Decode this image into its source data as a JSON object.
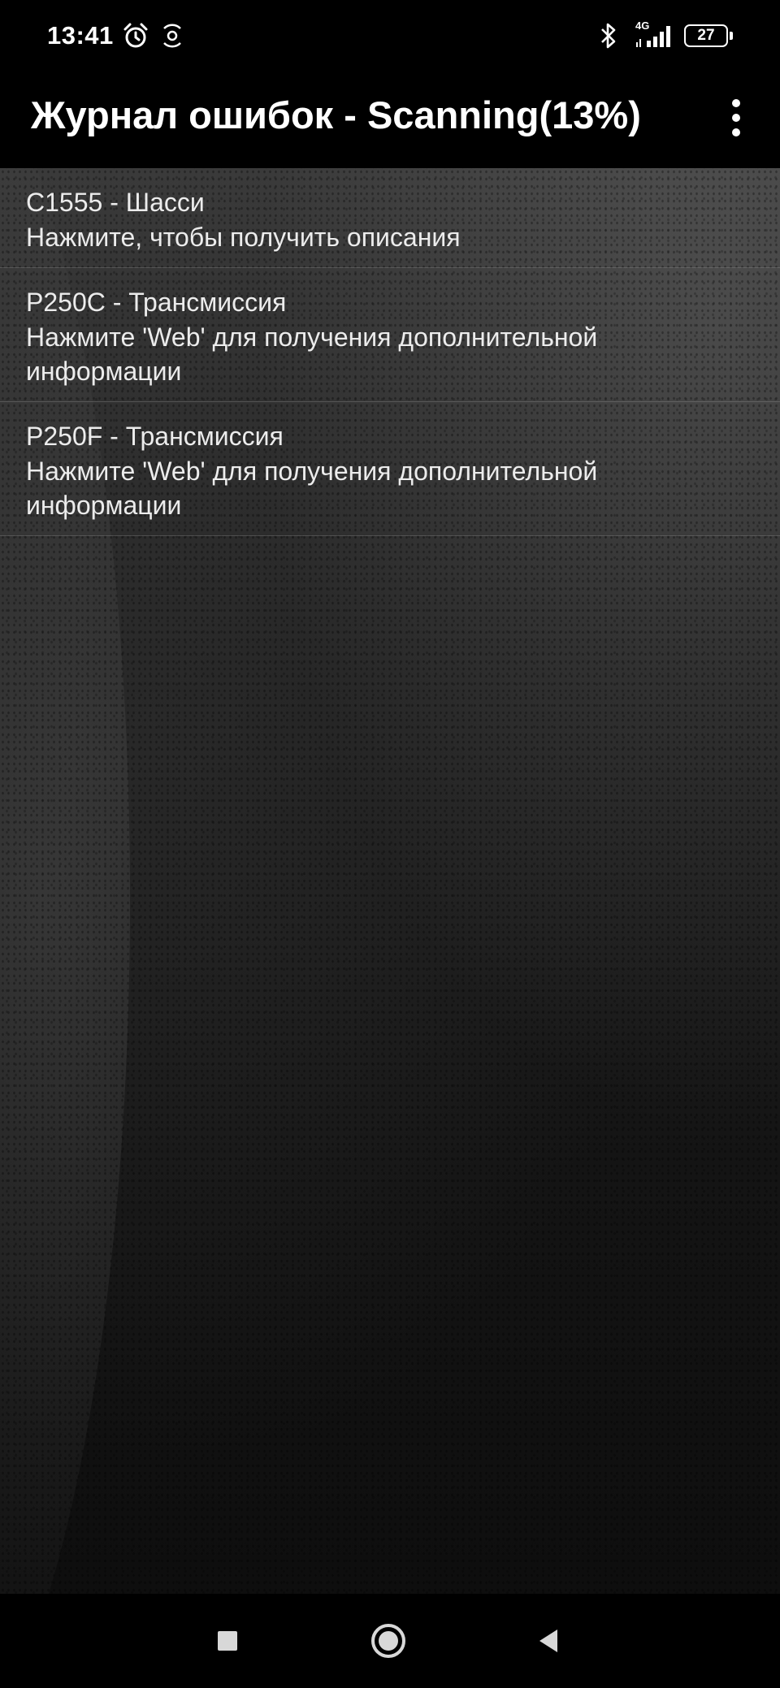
{
  "status_bar": {
    "time": "13:41",
    "network_label": "4G",
    "battery_level": "27",
    "icons": [
      "alarm-icon",
      "hearing-icon",
      "bluetooth-icon",
      "signal-icon",
      "battery-icon"
    ]
  },
  "app_bar": {
    "title": "Журнал ошибок - Scanning(13%)",
    "menu_icon": "more-vert-icon"
  },
  "error_log": {
    "items": [
      {
        "title": "C1555 - Шасси",
        "description": "Нажмите, чтобы получить описания"
      },
      {
        "title": "P250C - Трансмиссия",
        "description": "Нажмите 'Web' для получения дополнительной информации"
      },
      {
        "title": "P250F - Трансмиссия",
        "description": "Нажмите 'Web' для получения дополнительной информации"
      }
    ]
  },
  "nav_bar": {
    "buttons": [
      "recents-square-icon",
      "home-circle-icon",
      "back-triangle-icon"
    ]
  },
  "colors": {
    "background": "#000000",
    "text": "#ececec",
    "divider": "#969696"
  }
}
